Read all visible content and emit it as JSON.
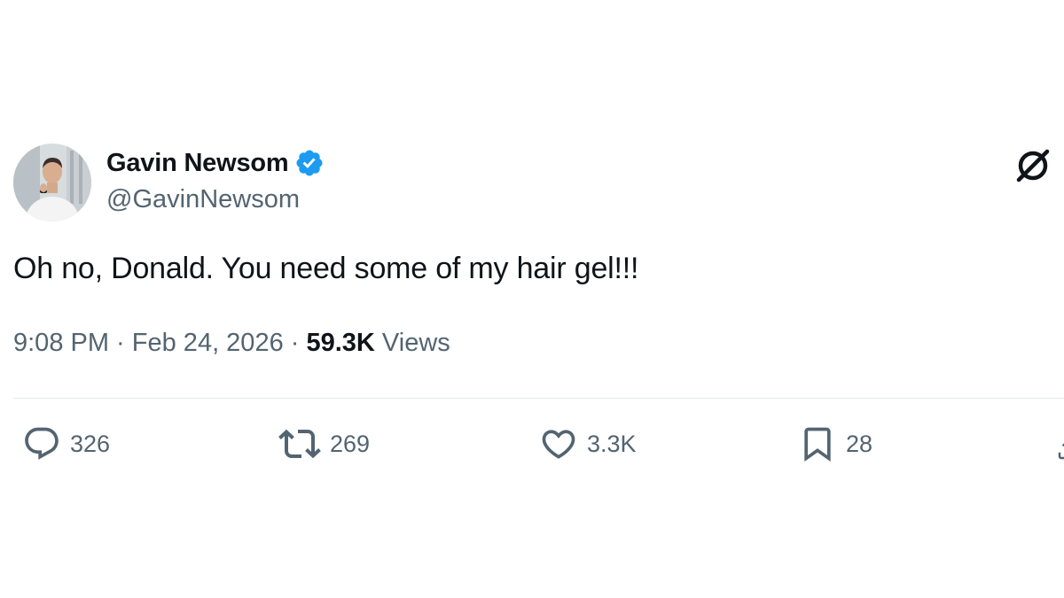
{
  "author": {
    "display_name": "Gavin Newsom",
    "handle": "@GavinNewsom",
    "verified": true,
    "verified_color": "#1d9bf0"
  },
  "tweet": {
    "text": "Oh no, Donald. You need some of my hair gel!!!",
    "time": "9:08 PM",
    "separator": " · ",
    "date": "Feb 24, 2026",
    "views_count": "59.3K",
    "views_label": " Views"
  },
  "actions": {
    "replies": {
      "icon": "reply-icon",
      "count": "326"
    },
    "retweets": {
      "icon": "retweet-icon",
      "count": "269"
    },
    "likes": {
      "icon": "heart-icon",
      "count": "3.3K"
    },
    "bookmarks": {
      "icon": "bookmark-icon",
      "count": "28"
    },
    "share": {
      "icon": "share-icon"
    }
  },
  "colors": {
    "text_primary": "#0f1419",
    "text_secondary": "#536471",
    "divider": "#e4e8eb"
  },
  "logo_icon": "x-logo-icon"
}
